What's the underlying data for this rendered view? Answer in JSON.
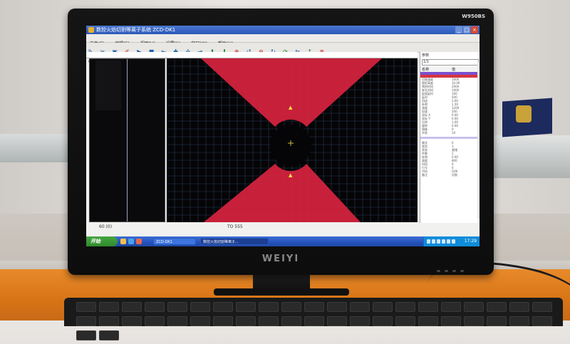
{
  "monitor": {
    "model": "W950BS",
    "brand": "WEIYI"
  },
  "app": {
    "title": "数控火焰切割等离子系统  ZCD-DK1",
    "menu": [
      "文件(F)",
      "编辑(E)",
      "视图(V)",
      "设置(S)",
      "窗口(W)",
      "帮助(H)"
    ],
    "tab_label": "0",
    "status_left": "60 (0)",
    "status_mid": "TO 555"
  },
  "right_panel": {
    "header": "参数",
    "select_value": "1/1",
    "col_a": "名称",
    "col_b": "值",
    "rows": [
      [
        "切割速度",
        "1000"
      ],
      [
        "割炬高度",
        "10.00"
      ],
      [
        "预热时间",
        "2000"
      ],
      [
        "穿孔时间",
        "1000"
      ],
      [
        "起弧延时",
        "100"
      ],
      [
        "延时",
        "500"
      ],
      [
        "回退",
        "3.00"
      ],
      [
        "补偿",
        "1.50"
      ],
      [
        "速度",
        "1200"
      ],
      [
        "加速",
        "200"
      ],
      [
        "坐标 X",
        "0.00"
      ],
      [
        "坐标 Y",
        "0.00"
      ],
      [
        "比例",
        "1.00"
      ],
      [
        "旋转",
        "0.00"
      ],
      [
        "镜像",
        "0"
      ],
      [
        "步距",
        "10"
      ]
    ],
    "rows2": [
      [
        "模式",
        "0"
      ],
      [
        "类型",
        "1"
      ],
      [
        "状态",
        "就绪"
      ],
      [
        "件数",
        "1"
      ],
      [
        "补偿",
        "0.00"
      ],
      [
        "速度",
        "800"
      ],
      [
        "时间",
        "0"
      ],
      [
        "行号",
        "0"
      ],
      [
        "代码",
        "G00"
      ],
      [
        "备注",
        "切割"
      ]
    ]
  },
  "taskbar": {
    "start_label": "开始",
    "tasks": [
      "ZCD-DK1",
      "数控火焰切割等离子..."
    ],
    "clock": "17:29"
  },
  "colors": {
    "cut_shape": "#d8233f",
    "grid": "#2a3a52",
    "canvas_bg": "#050507",
    "marker": "#ffe24a"
  }
}
